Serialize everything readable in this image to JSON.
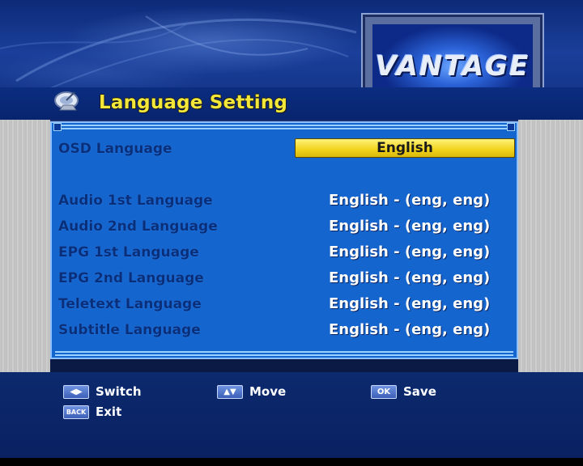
{
  "header": {
    "title": "Language Setting",
    "logo_text": "VANTAGE"
  },
  "settings": {
    "osd": {
      "label": "OSD Language",
      "value": "English"
    },
    "rows": [
      {
        "label": "Audio 1st Language",
        "value": "English - (eng, eng)"
      },
      {
        "label": "Audio 2nd Language",
        "value": "English - (eng, eng)"
      },
      {
        "label": "EPG 1st Language",
        "value": "English - (eng, eng)"
      },
      {
        "label": "EPG 2nd Language",
        "value": "English - (eng, eng)"
      },
      {
        "label": "Teletext Language",
        "value": "English - (eng, eng)"
      },
      {
        "label": "Subtitle Language",
        "value": "English - (eng, eng)"
      }
    ]
  },
  "footer": {
    "switch": {
      "key": "◀▶",
      "label": "Switch"
    },
    "move": {
      "key": "▲▼",
      "label": "Move"
    },
    "save": {
      "key": "OK",
      "label": "Save"
    },
    "exit": {
      "key": "BACK",
      "label": "Exit"
    }
  },
  "colors": {
    "panel": "#1565cf",
    "highlight": "#f0d21a",
    "title": "#f3e83a"
  }
}
